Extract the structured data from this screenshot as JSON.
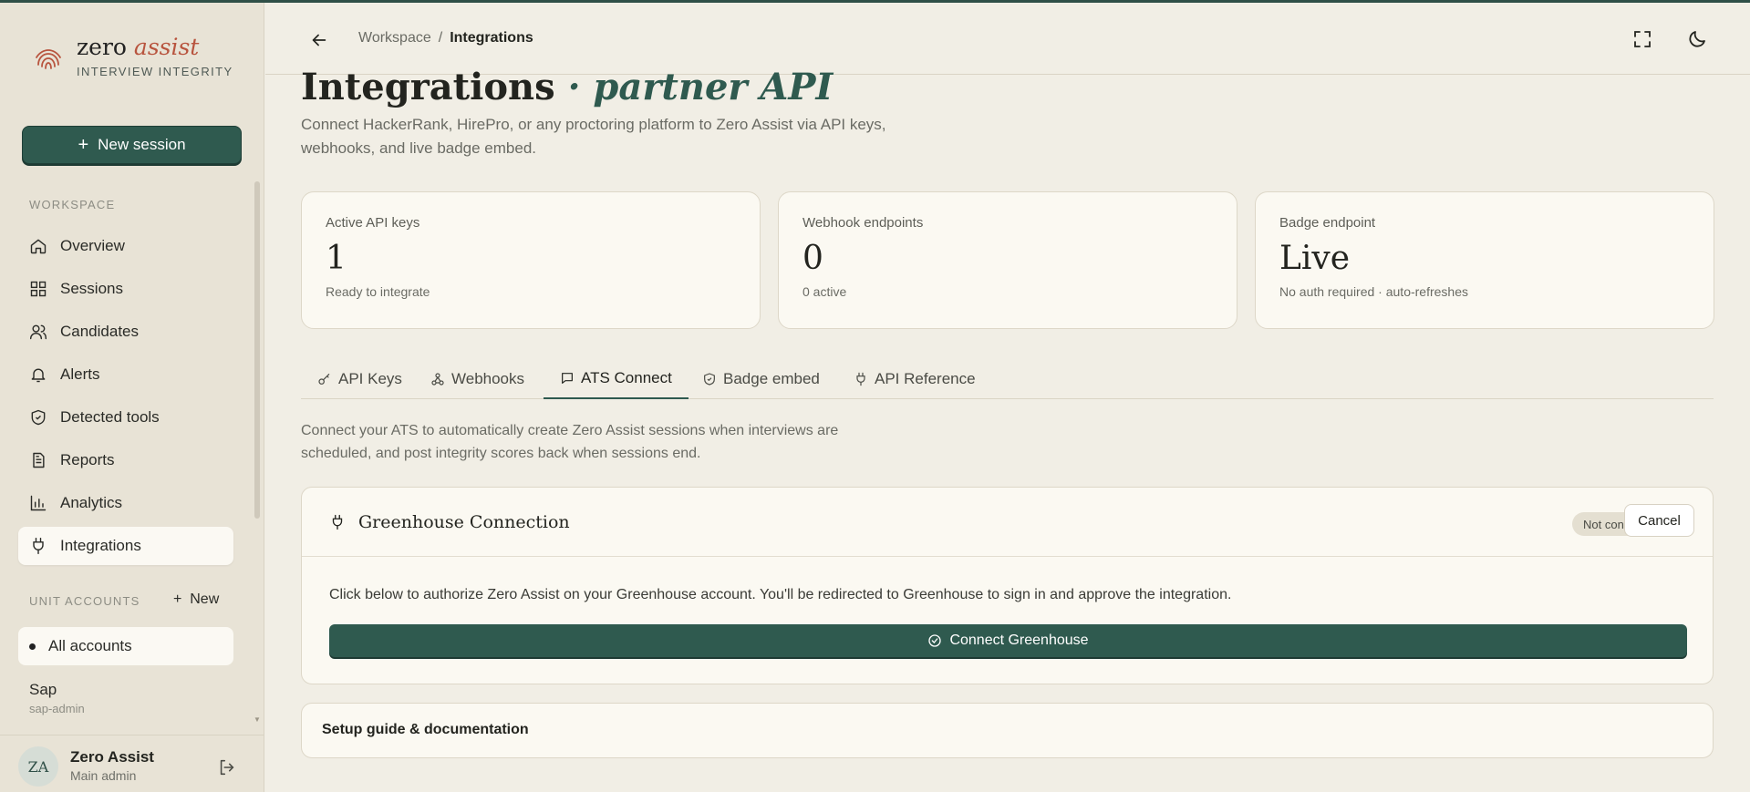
{
  "brand": {
    "name_plain": "zero",
    "name_accent": "assist",
    "subtitle": "INTERVIEW INTEGRITY"
  },
  "sidebar": {
    "new_session_label": "New session",
    "workspace_label": "WORKSPACE",
    "items": [
      {
        "label": "Overview",
        "icon": "home-icon"
      },
      {
        "label": "Sessions",
        "icon": "grid-icon"
      },
      {
        "label": "Candidates",
        "icon": "users-icon"
      },
      {
        "label": "Alerts",
        "icon": "bell-icon"
      },
      {
        "label": "Detected tools",
        "icon": "shield-icon"
      },
      {
        "label": "Reports",
        "icon": "document-icon"
      },
      {
        "label": "Analytics",
        "icon": "bar-chart-icon"
      },
      {
        "label": "Integrations",
        "icon": "plug-icon",
        "active": true
      }
    ],
    "unit_accounts_label": "UNIT ACCOUNTS",
    "unit_new_label": "New",
    "all_accounts_label": "All accounts",
    "account": {
      "name": "Sap",
      "id": "sap-admin"
    }
  },
  "user": {
    "initials": "ZA",
    "name": "Zero Assist",
    "role": "Main admin"
  },
  "header": {
    "crumb_parent": "Workspace",
    "crumb_sep": "/",
    "crumb_current": "Integrations"
  },
  "page": {
    "title": "Integrations",
    "title_accent": "· partner API",
    "description": "Connect HackerRank, HirePro, or any proctoring platform to Zero Assist via API keys, webhooks, and live badge embed."
  },
  "stats": [
    {
      "label": "Active API keys",
      "value": "1",
      "note": "Ready to integrate"
    },
    {
      "label": "Webhook endpoints",
      "value": "0",
      "note": "0 active"
    },
    {
      "label": "Badge endpoint",
      "value": "Live",
      "note": "No auth required · auto-refreshes"
    }
  ],
  "tabs": [
    {
      "label": "API Keys",
      "icon": "key-icon"
    },
    {
      "label": "Webhooks",
      "icon": "webhook-icon"
    },
    {
      "label": "ATS Connect",
      "icon": "message-icon",
      "active": true
    },
    {
      "label": "Badge embed",
      "icon": "shield-check-icon"
    },
    {
      "label": "API Reference",
      "icon": "plug-icon"
    }
  ],
  "ats": {
    "description": "Connect your ATS to automatically create Zero Assist sessions when interviews are scheduled, and post integrity scores back when sessions end.",
    "card_title": "Greenhouse Connection",
    "status_badge": "Not connected",
    "cancel_label": "Cancel",
    "instructions": "Click below to authorize Zero Assist on your Greenhouse account. You'll be redirected to Greenhouse to sign in and approve the integration.",
    "connect_label": "Connect Greenhouse"
  },
  "setup_label": "Setup guide & documentation",
  "colors": {
    "accent": "#2f5a4f",
    "brand_accent": "#b8543e",
    "background": "#f1eee5"
  }
}
